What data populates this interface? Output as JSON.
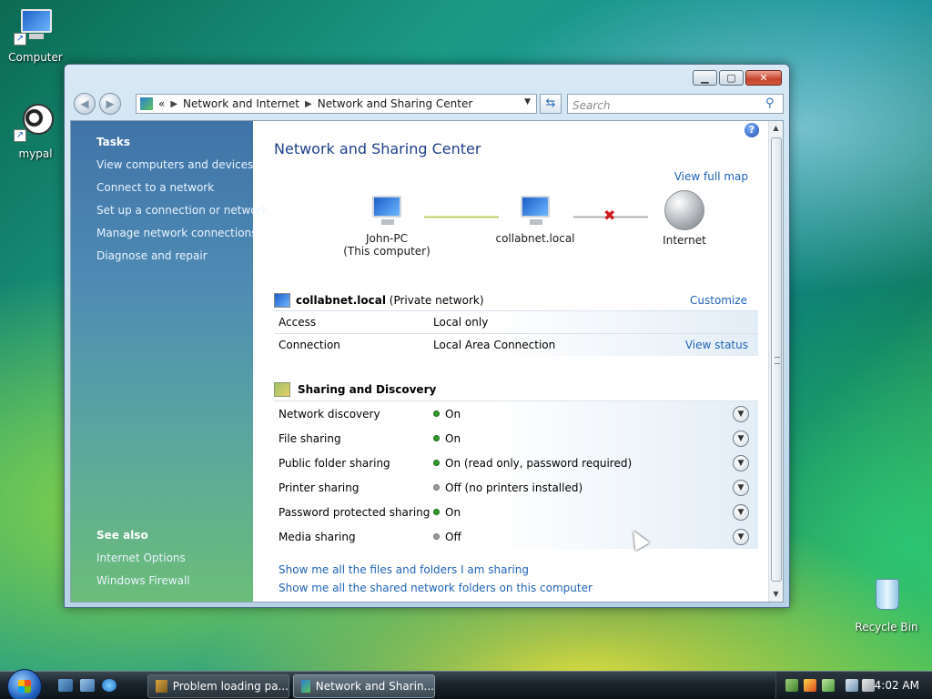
{
  "desktop": {
    "icons": [
      {
        "label": "Computer"
      },
      {
        "label": "mypal"
      },
      {
        "label": "Recycle Bin"
      }
    ]
  },
  "window": {
    "address": {
      "prefix": "«",
      "crumb1": "Network and Internet",
      "crumb2": "Network and Sharing Center"
    },
    "search_placeholder": "Search",
    "left": {
      "tasks_heading": "Tasks",
      "tasks": [
        "View computers and devices",
        "Connect to a network",
        "Set up a connection or network",
        "Manage network connections",
        "Diagnose and repair"
      ],
      "see_also_heading": "See also",
      "see_also": [
        "Internet Options",
        "Windows Firewall"
      ]
    },
    "main": {
      "title": "Network and Sharing Center",
      "view_full_map": "View full map",
      "map": {
        "computer_name": "John-PC",
        "computer_sub": "(This computer)",
        "network_name": "collabnet.local",
        "internet": "Internet"
      },
      "network": {
        "name": "collabnet.local",
        "type": "(Private network)",
        "customize": "Customize",
        "rows": [
          {
            "label": "Access",
            "value": "Local only",
            "link": ""
          },
          {
            "label": "Connection",
            "value": "Local Area Connection",
            "link": "View status"
          }
        ]
      },
      "sharing": {
        "heading": "Sharing and Discovery",
        "rows": [
          {
            "label": "Network discovery",
            "status": "on",
            "value": "On"
          },
          {
            "label": "File sharing",
            "status": "on",
            "value": "On"
          },
          {
            "label": "Public folder sharing",
            "status": "on",
            "value": "On (read only, password required)"
          },
          {
            "label": "Printer sharing",
            "status": "off",
            "value": "Off (no printers installed)"
          },
          {
            "label": "Password protected sharing",
            "status": "on",
            "value": "On"
          },
          {
            "label": "Media sharing",
            "status": "off",
            "value": "Off"
          }
        ]
      },
      "links": [
        "Show me all the files and folders I am sharing",
        "Show me all the shared network folders on this computer"
      ]
    }
  },
  "taskbar": {
    "buttons": [
      {
        "label": "Problem loading pa...",
        "active": false
      },
      {
        "label": "Network and Sharin...",
        "active": true
      }
    ],
    "clock": "4:02 AM"
  }
}
